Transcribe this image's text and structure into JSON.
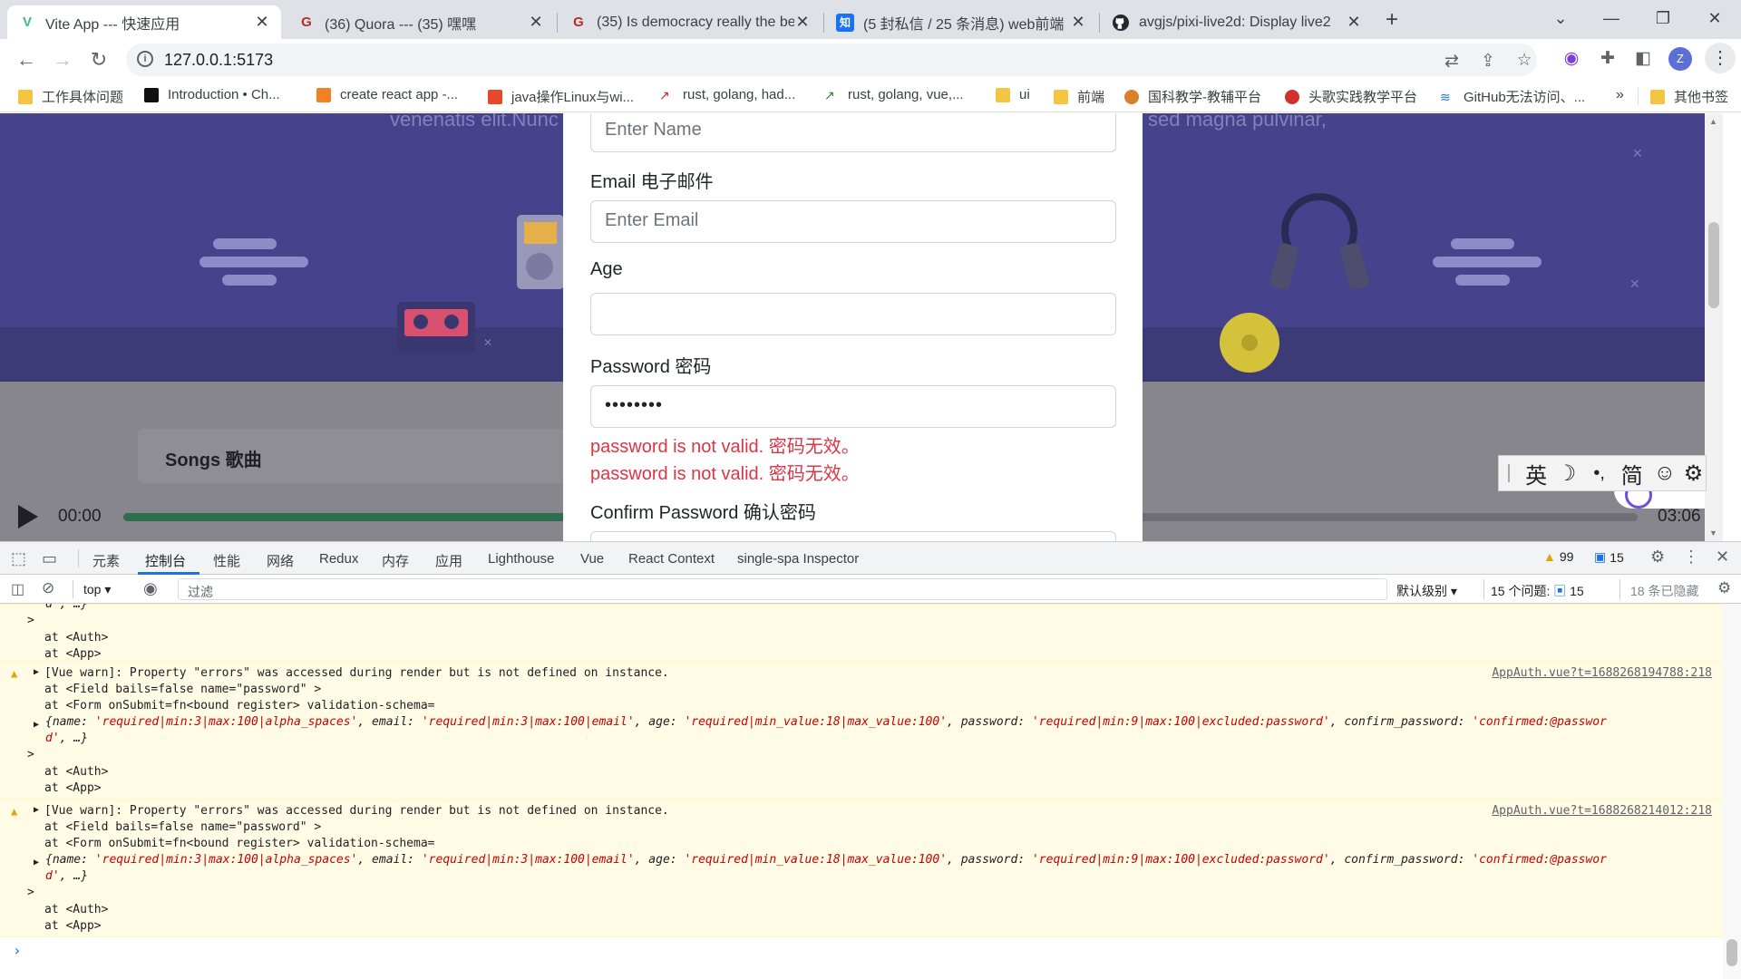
{
  "tabs": [
    {
      "title": "Vite App --- 快速应用",
      "fav": "V",
      "favColor": "#41b883"
    },
    {
      "title": "(36) Quora ---  (35)  嘿嘿",
      "fav": "G",
      "favColor": "#b92b27"
    },
    {
      "title": "(35) Is democracy really the be",
      "fav": "G",
      "favColor": "#b92b27"
    },
    {
      "title": "(5 封私信 / 25 条消息) web前端",
      "fav": "知",
      "favColor": "#1772f6"
    },
    {
      "title": "avgjs/pixi-live2d: Display live2",
      "fav": "gh",
      "favColor": "#24292f"
    }
  ],
  "toolbar": {
    "url": "127.0.0.1:5173",
    "profile": "Z"
  },
  "bookmarks": [
    {
      "label": "工作具体问题",
      "type": "folder"
    },
    {
      "label": "Introduction • Ch...",
      "type": "site"
    },
    {
      "label": "create react app -...",
      "type": "site"
    },
    {
      "label": "java操作Linux与wi...",
      "type": "site"
    },
    {
      "label": "rust, golang, had...",
      "type": "site"
    },
    {
      "label": "rust, golang, vue,...",
      "type": "site"
    },
    {
      "label": "ui",
      "type": "folder"
    },
    {
      "label": "前端",
      "type": "folder"
    },
    {
      "label": "国科教学-教辅平台",
      "type": "site"
    },
    {
      "label": "头歌实践教学平台",
      "type": "site"
    },
    {
      "label": "GitHub无法访问、...",
      "type": "site"
    },
    {
      "label": "»",
      "type": "more"
    },
    {
      "label": "其他书签",
      "type": "folder"
    }
  ],
  "page": {
    "bg_text_left": "venenatis elit.Nunc",
    "bg_text_right": "sed magna pulvinar,",
    "songs_label": "Songs 歌曲",
    "time_current": "00:00",
    "time_total": "03:06",
    "progress": 0.55
  },
  "form": {
    "name_placeholder": "Enter Name",
    "email_label": "Email 电子邮件",
    "email_placeholder": "Enter Email",
    "age_label": "Age",
    "password_label": "Password 密码",
    "password_value": "••••••••",
    "error1": "password is not valid. 密码无效。",
    "error2": "password is not valid. 密码无效。",
    "confirm_label": "Confirm Password 确认密码"
  },
  "ime": {
    "lang": "英",
    "moon": "☽",
    "punct": "•,",
    "simp": "简",
    "emoji": "☺",
    "gear": "⚙"
  },
  "devtools": {
    "tabs": [
      "元素",
      "控制台",
      "性能",
      "网络",
      "Redux",
      "内存",
      "应用",
      "Lighthouse",
      "Vue",
      "React Context",
      "single-spa Inspector"
    ],
    "warnings_count": "99",
    "messages_count": "15",
    "context": "top",
    "filter_placeholder": "过滤",
    "level": "默认级别",
    "issues_label": "15 个问题:",
    "issues_count": "15",
    "hidden": "18 条已隐藏"
  },
  "console": {
    "top_line": "d', …}",
    "top_at1": "at <Auth>",
    "top_at2": "at <App>",
    "warn_msg": "[Vue warn]: Property \"errors\" was accessed during render but is not defined on instance.",
    "field_line": "at <Field bails=false name=\"password\" >",
    "form_line": "at <Form onSubmit=fn<bound register> validation-schema=",
    "schema_open": "{name: ",
    "schema_name": "'required|min:3|max:100|alpha_spaces'",
    "schema_email_k": ", email: ",
    "schema_email": "'required|min:3|max:100|email'",
    "schema_age_k": ", age: ",
    "schema_age": "'required|min_value:18|max_value:100'",
    "schema_pw_k": ", password: ",
    "schema_pw": "'required|min:9|max:100|excluded:password'",
    "schema_cp_k": ", confirm_password: ",
    "schema_cp": "'confirmed:@passwor",
    "schema_tail1": "d'",
    "schema_tail2": ", …}",
    "caret": ">",
    "at_auth": "at <Auth>",
    "at_app": "at <App>",
    "src1": "AppAuth.vue?t=1688268194788:218",
    "src2": "AppAuth.vue?t=1688268214012:218",
    "prompt": "›"
  }
}
